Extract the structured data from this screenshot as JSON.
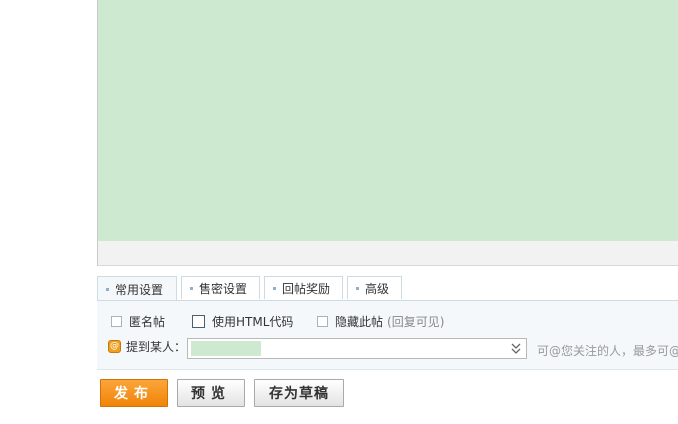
{
  "tabs": [
    {
      "label": "常用设置",
      "active": true
    },
    {
      "label": "售密设置",
      "active": false
    },
    {
      "label": "回帖奖励",
      "active": false
    },
    {
      "label": "高级",
      "active": false
    }
  ],
  "options": {
    "anonymous": "匿名帖",
    "use_html": "使用HTML代码",
    "hide_post": "隐藏此帖",
    "hide_post_note": "(回复可见)"
  },
  "mention": {
    "label": "提到某人：",
    "hint": "可@您关注的人，最多可@"
  },
  "buttons": {
    "publish": "发布",
    "preview": "预览",
    "save_draft": "存为草稿"
  },
  "colors": {
    "editor_bg": "#cde9d0",
    "publish_orange": "#f18408",
    "panel_bg": "#f4f8fb"
  },
  "icons": {
    "mention": "at-icon",
    "dropdown": "chevron-down-icon"
  }
}
